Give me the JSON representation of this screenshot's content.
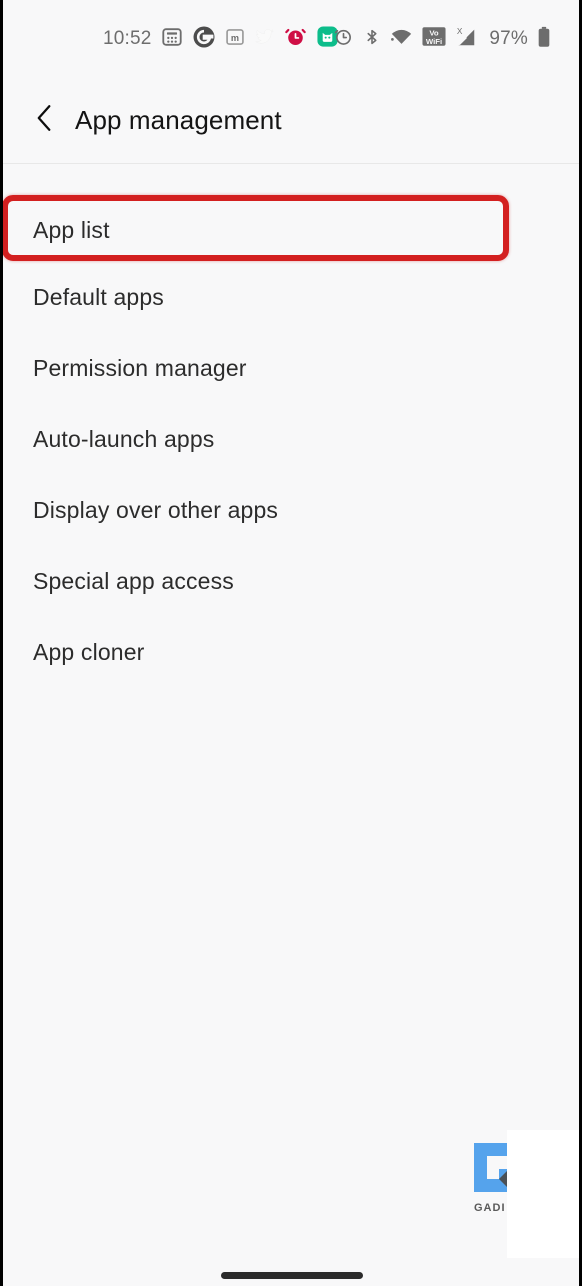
{
  "status_bar": {
    "time": "10:52",
    "battery_percent": "97%",
    "left_icons": [
      {
        "name": "calculator-icon",
        "glyph": "calculator"
      },
      {
        "name": "google-icon",
        "glyph": "G"
      },
      {
        "name": "mastodon-icon",
        "glyph": "m"
      },
      {
        "name": "twitter-icon",
        "glyph": "bird"
      },
      {
        "name": "alarm-app-icon",
        "glyph": "alarm"
      },
      {
        "name": "mi-home-icon",
        "glyph": "cat"
      }
    ],
    "right_icons": [
      {
        "name": "alarm-set-icon"
      },
      {
        "name": "bluetooth-icon"
      },
      {
        "name": "wifi-icon"
      },
      {
        "name": "vowifi-icon",
        "label_top": "Vo",
        "label_bottom": "WiFi"
      },
      {
        "name": "cellular-signal-icon",
        "superscript": "X"
      },
      {
        "name": "battery-icon"
      }
    ],
    "colors": {
      "google_red": "#ea4335",
      "alarm_crimson": "#cf0e45",
      "mi_home_teal": "#0dbd8b",
      "icon_gray": "#6d6d6d"
    }
  },
  "header": {
    "back_label": "Back",
    "title": "App management"
  },
  "list": {
    "items": [
      {
        "label": "App list",
        "highlighted": true
      },
      {
        "label": "Default apps",
        "highlighted": false
      },
      {
        "label": "Permission manager",
        "highlighted": false
      },
      {
        "label": "Auto-launch apps",
        "highlighted": false
      },
      {
        "label": "Display over other apps",
        "highlighted": false
      },
      {
        "label": "Special app access",
        "highlighted": false
      },
      {
        "label": "App cloner",
        "highlighted": false
      }
    ]
  },
  "annotation": {
    "highlight_color": "#d32020",
    "target": "App list"
  },
  "watermark": {
    "mark": "GU",
    "text": "GADI",
    "blue": "#55a3ec",
    "gray": "#5a5a5a"
  },
  "nav": {
    "gesture_bar_label": "Home gesture bar"
  }
}
